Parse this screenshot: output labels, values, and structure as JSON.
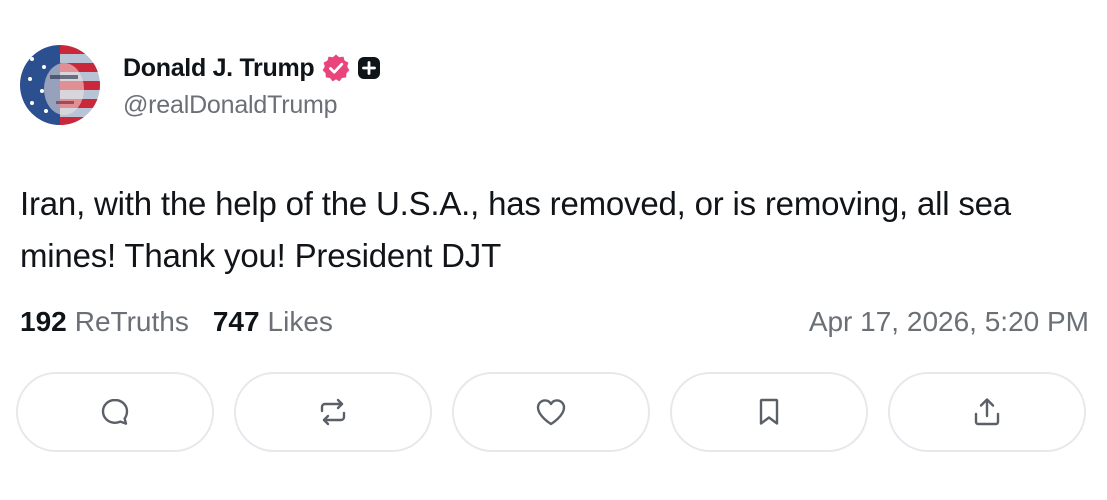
{
  "author": {
    "display_name": "Donald J. Trump",
    "handle": "@realDonaldTrump",
    "verified_badge_icon": "verified-badge-icon",
    "plus_badge_icon": "plus-badge-icon",
    "colors": {
      "verified": "#e9457c",
      "plus_badge": "#0f1419"
    }
  },
  "post": {
    "text": "Iran, with the help of the U.S.A., has removed, or is removing, all sea mines! Thank you! President DJT"
  },
  "stats": {
    "retruths_count": "192",
    "retruths_label": "ReTruths",
    "likes_count": "747",
    "likes_label": "Likes",
    "timestamp": "Apr 17, 2026, 5:20 PM"
  },
  "actions": [
    {
      "name": "reply",
      "icon": "comment-icon"
    },
    {
      "name": "retruth",
      "icon": "repost-icon"
    },
    {
      "name": "like",
      "icon": "heart-icon"
    },
    {
      "name": "bookmark",
      "icon": "bookmark-icon"
    },
    {
      "name": "share",
      "icon": "share-icon"
    }
  ]
}
